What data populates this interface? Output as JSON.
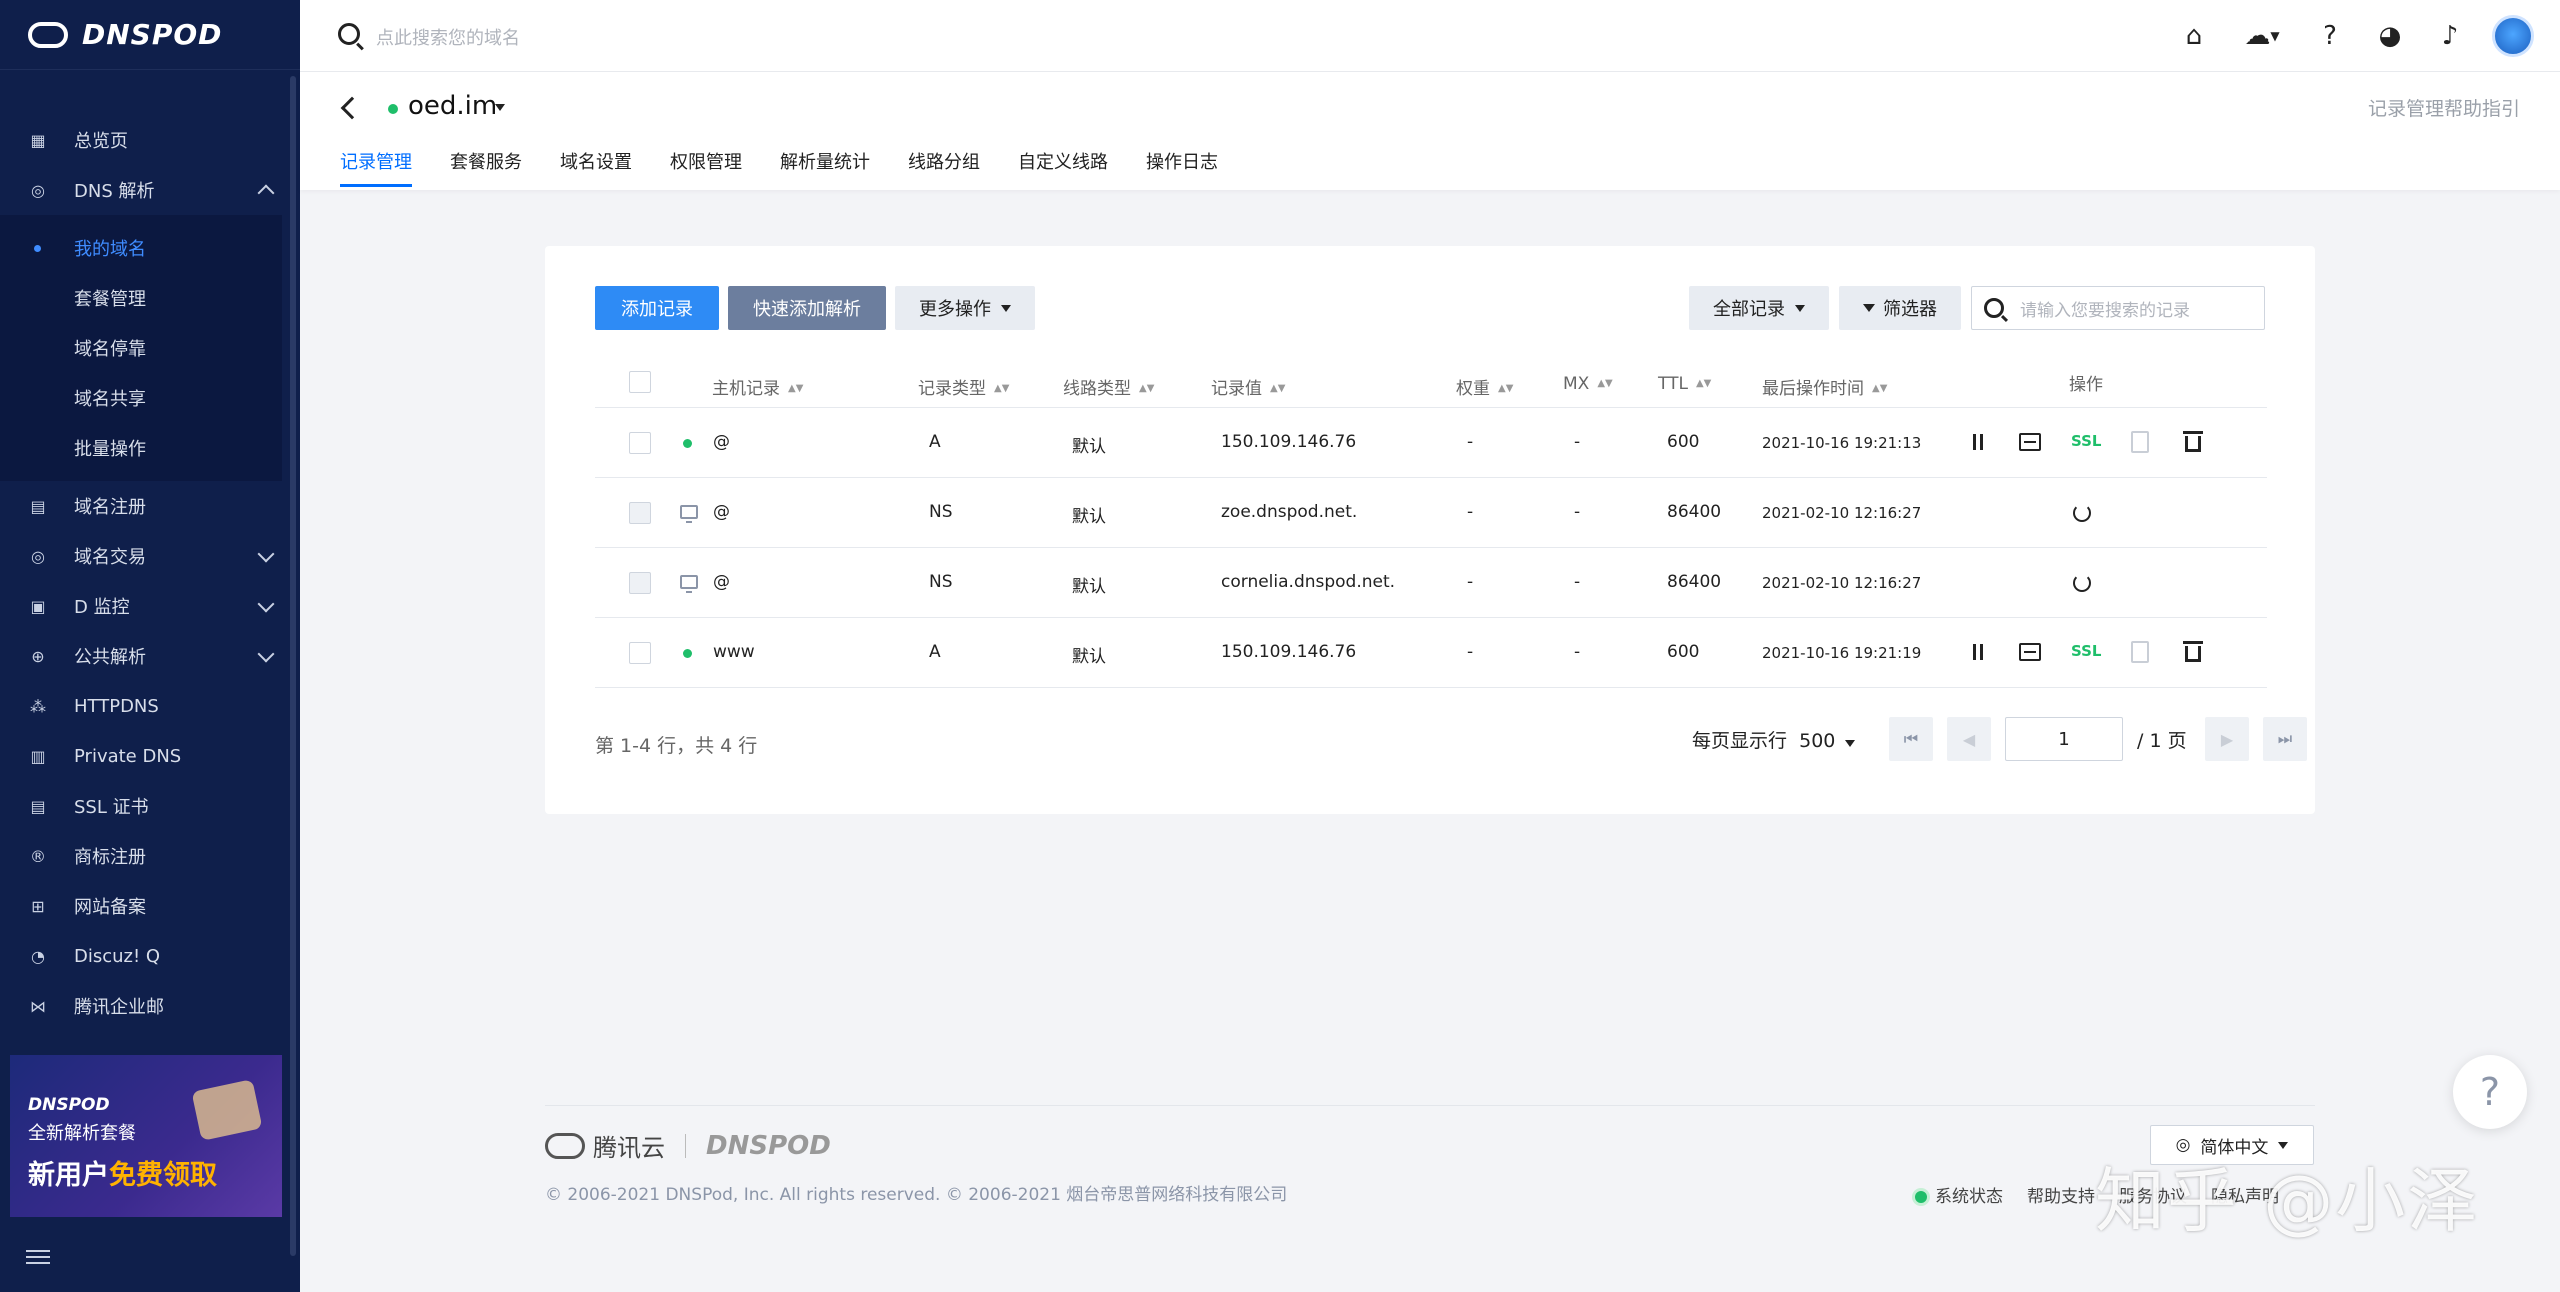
{
  "brand": {
    "name": "DNSPOD"
  },
  "sidebar": {
    "items": [
      {
        "label": "总览页"
      },
      {
        "label": "DNS 解析"
      },
      {
        "label": "域名注册"
      },
      {
        "label": "域名交易"
      },
      {
        "label": "D 监控"
      },
      {
        "label": "公共解析"
      },
      {
        "label": "HTTPDNS"
      },
      {
        "label": "Private DNS"
      },
      {
        "label": "SSL 证书"
      },
      {
        "label": "商标注册"
      },
      {
        "label": "网站备案"
      },
      {
        "label": "Discuz! Q"
      },
      {
        "label": "腾讯企业邮"
      }
    ],
    "dns_sub": [
      {
        "label": "我的域名"
      },
      {
        "label": "套餐管理"
      },
      {
        "label": "域名停靠"
      },
      {
        "label": "域名共享"
      },
      {
        "label": "批量操作"
      }
    ],
    "promo": {
      "brand": "DNSPOD",
      "line1": "全新解析套餐",
      "line2a": "新用户",
      "line2b": "免费领取"
    }
  },
  "topbar": {
    "search_placeholder": "点此搜索您的域名"
  },
  "header": {
    "domain": "oed.im",
    "help_link": "记录管理帮助指引",
    "tabs": [
      {
        "label": "记录管理"
      },
      {
        "label": "套餐服务"
      },
      {
        "label": "域名设置"
      },
      {
        "label": "权限管理"
      },
      {
        "label": "解析量统计"
      },
      {
        "label": "线路分组"
      },
      {
        "label": "自定义线路"
      },
      {
        "label": "操作日志"
      }
    ]
  },
  "toolbar": {
    "add": "添加记录",
    "quick_add": "快速添加解析",
    "more": "更多操作",
    "all_records": "全部记录",
    "filter": "筛选器",
    "search_placeholder": "请输入您要搜索的记录"
  },
  "table": {
    "headers": {
      "host": "主机记录",
      "type": "记录类型",
      "line": "线路类型",
      "value": "记录值",
      "weight": "权重",
      "mx": "MX",
      "ttl": "TTL",
      "time": "最后操作时间",
      "ops": "操作"
    },
    "rows": [
      {
        "host": "@",
        "type": "A",
        "line": "默认",
        "value": "150.109.146.76",
        "weight": "-",
        "mx": "-",
        "ttl": "600",
        "time": "2021-10-16 19:21:13",
        "ssl": "SSL"
      },
      {
        "host": "@",
        "type": "NS",
        "line": "默认",
        "value": "zoe.dnspod.net.",
        "weight": "-",
        "mx": "-",
        "ttl": "86400",
        "time": "2021-02-10 12:16:27"
      },
      {
        "host": "@",
        "type": "NS",
        "line": "默认",
        "value": "cornelia.dnspod.net.",
        "weight": "-",
        "mx": "-",
        "ttl": "86400",
        "time": "2021-02-10 12:16:27"
      },
      {
        "host": "www",
        "type": "A",
        "line": "默认",
        "value": "150.109.146.76",
        "weight": "-",
        "mx": "-",
        "ttl": "600",
        "time": "2021-10-16 19:21:19",
        "ssl": "SSL"
      }
    ]
  },
  "pagination": {
    "info": "第 1-4 行，共 4 行",
    "page_size_label": "每页显示行",
    "page_size": "500",
    "current_page": "1",
    "total_pages": "/ 1 页"
  },
  "footer": {
    "tencent": "腾讯云",
    "dnspod": "DNSPOD",
    "copyright": "© 2006-2021 DNSPod, Inc. All rights reserved. © 2006-2021 烟台帝思普网络科技有限公司",
    "language": "简体中文",
    "links": [
      "系统状态",
      "帮助支持",
      "服务协议",
      "隐私声明"
    ]
  },
  "watermark": "知乎 @小泽",
  "colors": {
    "sidebar": "#0f1f4b",
    "primary": "#2e8bf5",
    "active_tab": "#006eff",
    "status_green": "#1fbe6a"
  }
}
